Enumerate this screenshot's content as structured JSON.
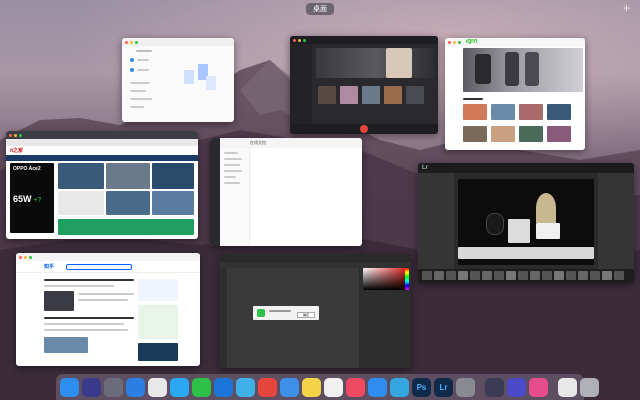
{
  "top_bar": {
    "desktop_label": "桌面",
    "add_label": "+"
  },
  "windows": {
    "browser_blog": {
      "brand": "it之家",
      "promo_title": "OPPO Ace2",
      "promo_big": "65W",
      "promo_small": "+?"
    },
    "video": {
      "brand": "iQIYI"
    },
    "lightroom": {
      "brand": "Lr"
    },
    "editor": {
      "title": "在线文档"
    },
    "news": {
      "brand": "知乎"
    },
    "photoshop": {
      "dialog_btn": "确定"
    }
  },
  "dock": {
    "items": [
      {
        "name": "finder-icon",
        "label": "",
        "color": "#2e8ef0"
      },
      {
        "name": "siri-icon",
        "label": "",
        "color": "#3a3a8c"
      },
      {
        "name": "launchpad-icon",
        "label": "",
        "color": "#6b6b7a"
      },
      {
        "name": "safari-icon",
        "label": "",
        "color": "#2c7fe0"
      },
      {
        "name": "chrome-icon",
        "label": "",
        "color": "#e8e8e8"
      },
      {
        "name": "qq-icon",
        "label": "",
        "color": "#2aa8f2"
      },
      {
        "name": "wechat-icon",
        "label": "",
        "color": "#2ec148"
      },
      {
        "name": "windows-icon",
        "label": "",
        "color": "#1d74d8"
      },
      {
        "name": "mindnode-icon",
        "label": "",
        "color": "#3fb0e8"
      },
      {
        "name": "netease-music-icon",
        "label": "",
        "color": "#e5453a"
      },
      {
        "name": "mail-icon",
        "label": "",
        "color": "#3d8fe8"
      },
      {
        "name": "notes-icon",
        "label": "",
        "color": "#f4d349"
      },
      {
        "name": "photos-icon",
        "label": "",
        "color": "#f0f0f0"
      },
      {
        "name": "music-icon",
        "label": "",
        "color": "#f04a62"
      },
      {
        "name": "appstore-icon",
        "label": "",
        "color": "#2f8cf0"
      },
      {
        "name": "telegram-icon",
        "label": "",
        "color": "#36a6e0"
      },
      {
        "name": "photoshop-icon",
        "label": "Ps",
        "color": "#0f2a4a"
      },
      {
        "name": "lightroom-icon",
        "label": "Lr",
        "color": "#0f2a4a"
      },
      {
        "name": "settings-icon",
        "label": "",
        "color": "#8a8a92"
      },
      {
        "name": "sep",
        "label": "",
        "color": ""
      },
      {
        "name": "screen-record-icon",
        "label": "",
        "color": "#3b3b55"
      },
      {
        "name": "browser-icon",
        "label": "",
        "color": "#4a4ac8"
      },
      {
        "name": "pink-app-icon",
        "label": "",
        "color": "#e94c8a"
      },
      {
        "name": "sep",
        "label": "",
        "color": ""
      },
      {
        "name": "document-icon",
        "label": "",
        "color": "#e8e8e8"
      },
      {
        "name": "trash-icon",
        "label": "",
        "color": "#b0b0b8"
      }
    ]
  },
  "colors": {
    "accent": "#2f8cf0",
    "iqiyi": "#00be06",
    "music_red": "#e5453a"
  }
}
